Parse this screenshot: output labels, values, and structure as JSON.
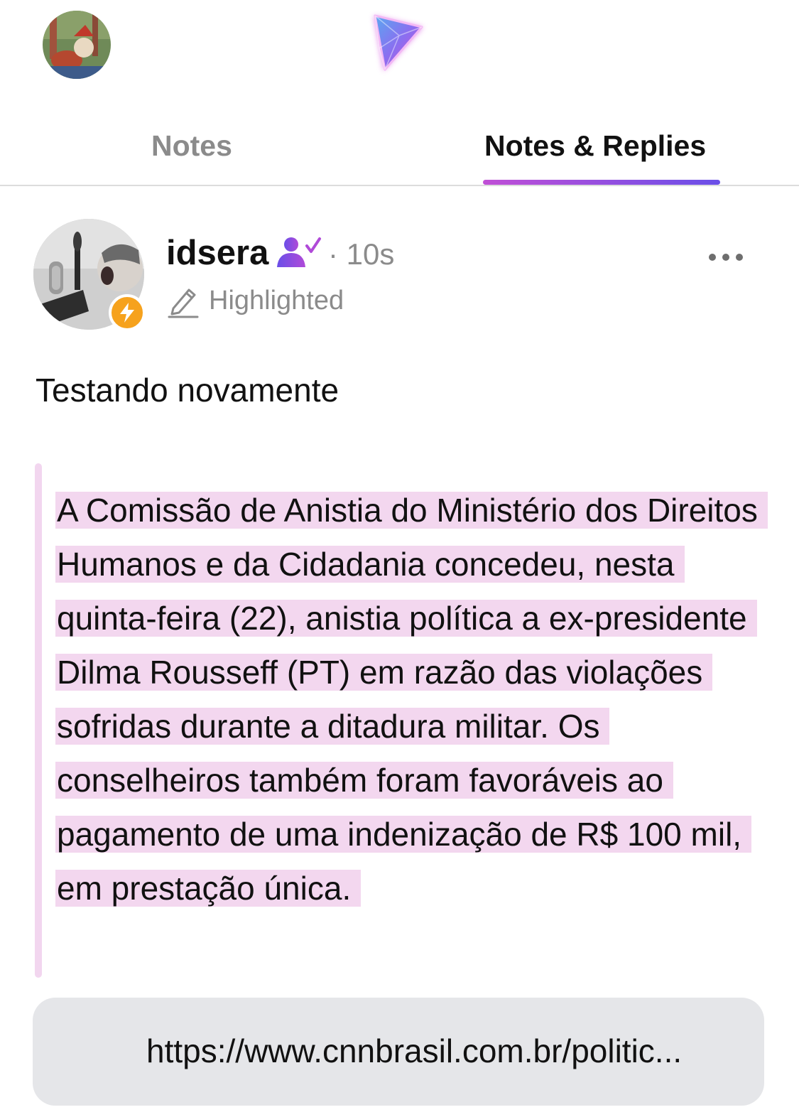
{
  "header": {
    "user_avatar_icon": "user-avatar",
    "logo_icon": "app-logo-icon"
  },
  "tabs": [
    {
      "label": "Notes",
      "active": false
    },
    {
      "label": "Notes & Replies",
      "active": true
    }
  ],
  "post": {
    "author": "idsera",
    "timestamp": "· 10s",
    "badge_icon": "lightning-bolt-icon",
    "subscriber_icon": "verified-subscriber-icon",
    "highlight_label": "Highlighted",
    "text": "Testando novamente",
    "quote": "A Comissão de Anistia do Ministério dos Direitos Humanos e da Cidadania concedeu, nesta quinta-feira (22), anistia política a ex-presidente Dilma Rousseff (PT) em razão das violações sofridas durante a ditadura militar. Os conselheiros também foram favoráveis ao pagamento de uma indenização de R$ 100 mil, em prestação única.",
    "link": "https://www.cnnbrasil.com.br/politic..."
  },
  "colors": {
    "accent_start": "#c04fd6",
    "accent_end": "#6a4fe8",
    "highlight_bg": "#f3d7ef",
    "badge": "#f6a21d",
    "muted_text": "#8b8b8b",
    "link_card_bg": "#e5e6e9"
  }
}
